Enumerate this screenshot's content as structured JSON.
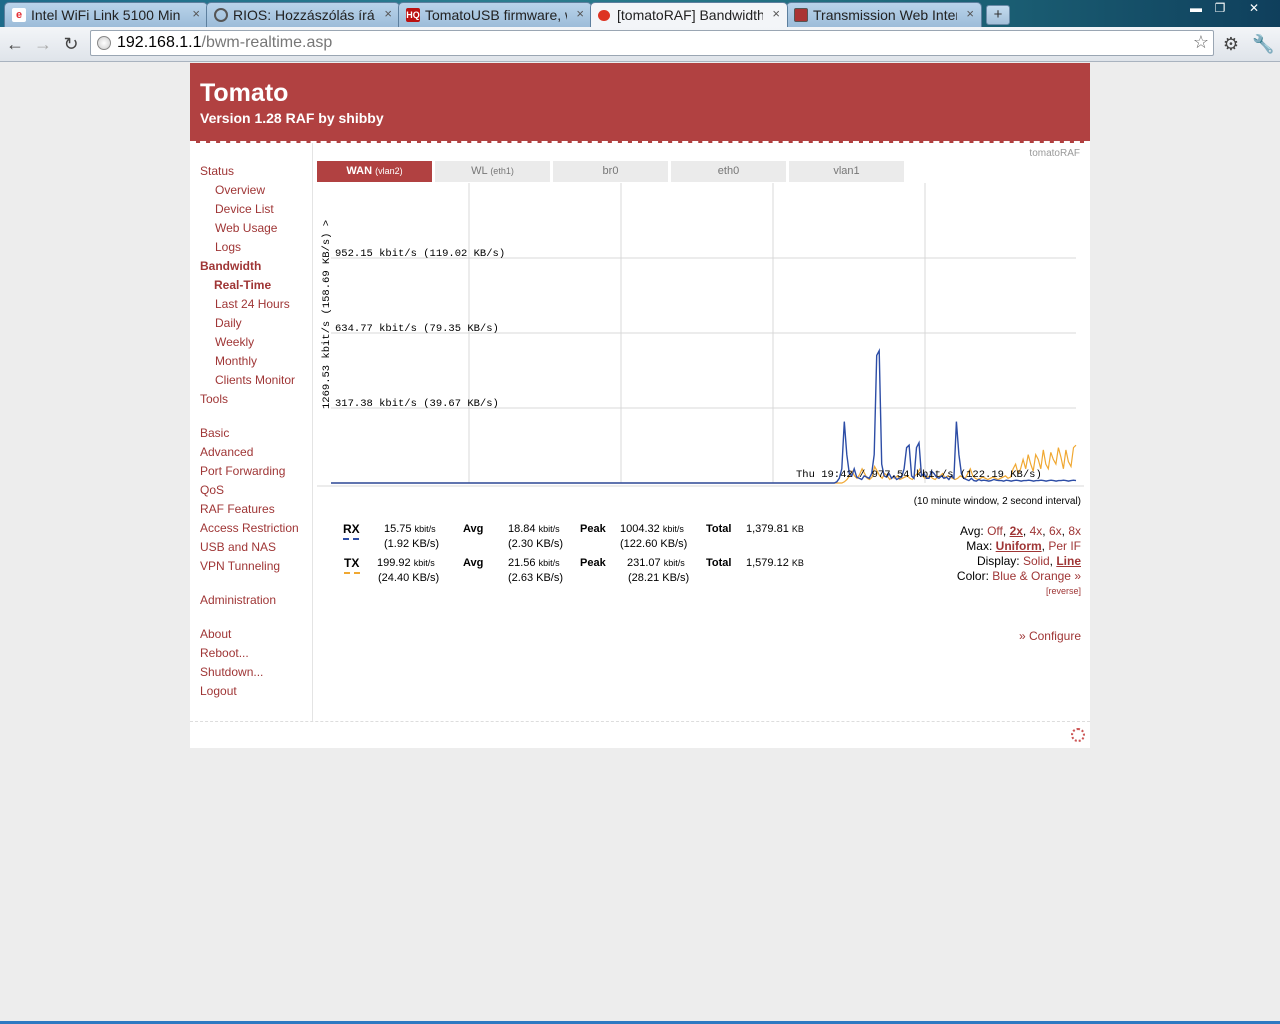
{
  "browser": {
    "tabs": [
      {
        "title": "Intel WiFi Link 5100 Min",
        "icon": "ebay-icon"
      },
      {
        "title": "RIOS: Hozzászólás írása",
        "icon": "forum-icon"
      },
      {
        "title": "TomatoUSB firmware, w",
        "icon": "hq-icon"
      },
      {
        "title": "[tomatoRAF] Bandwidth",
        "icon": "tomato-icon"
      },
      {
        "title": "Transmission Web Inter",
        "icon": "transmission-icon"
      }
    ],
    "url_host": "192.168.1.1",
    "url_path": "/bwm-realtime.asp",
    "tab_close_glyph": "×",
    "newtab_glyph": "+",
    "fav_hq": "HQ"
  },
  "header": {
    "title": "Tomato",
    "subtitle": "Version 1.28 RAF by shibby"
  },
  "sidebar": {
    "status": "Status",
    "overview": "Overview",
    "device_list": "Device List",
    "web_usage": "Web Usage",
    "logs": "Logs",
    "bandwidth": "Bandwidth",
    "real_time": "Real-Time",
    "last24": "Last 24 Hours",
    "daily": "Daily",
    "weekly": "Weekly",
    "monthly": "Monthly",
    "clients_monitor": "Clients Monitor",
    "tools": "Tools",
    "basic": "Basic",
    "advanced": "Advanced",
    "port_forwarding": "Port Forwarding",
    "qos": "QoS",
    "raf_features": "RAF Features",
    "access_restriction": "Access Restriction",
    "usb_nas": "USB and NAS",
    "vpn": "VPN Tunneling",
    "administration": "Administration",
    "about": "About",
    "reboot": "Reboot...",
    "shutdown": "Shutdown...",
    "logout": "Logout"
  },
  "brand": "tomatoRAF",
  "iface_tabs": [
    {
      "name": "WAN",
      "sub": "(vlan2)"
    },
    {
      "name": "WL",
      "sub": "(eth1)"
    },
    {
      "name": "br0",
      "sub": ""
    },
    {
      "name": "eth0",
      "sub": ""
    },
    {
      "name": "vlan1",
      "sub": ""
    }
  ],
  "graph": {
    "max_label": "1269.53 kbit/s (158.69 KB/s) >",
    "gridlines": [
      "952.15 kbit/s (119.02 KB/s)",
      "634.77 kbit/s (79.35 KB/s)",
      "317.38 kbit/s (39.67 KB/s)"
    ],
    "cursor_label": "Thu 19:42 / 977.54 kbit/s (122.19 KB/s)",
    "colors": {
      "rx": "#2d4da6",
      "tx": "#f0a832",
      "grid": "#d8d8d8"
    }
  },
  "chart_data": {
    "type": "line",
    "ylim": [
      0,
      1269.53
    ],
    "yunit": "kbit/s",
    "series": [
      {
        "name": "RX",
        "values": [
          0,
          0,
          0,
          0,
          0,
          0,
          0,
          0,
          0,
          0,
          0,
          0,
          0,
          0,
          0,
          0,
          0,
          0,
          0,
          0,
          0,
          0,
          0,
          0,
          0,
          0,
          0,
          0,
          0,
          0,
          0,
          0,
          0,
          0,
          0,
          0,
          0,
          0,
          0,
          0,
          0,
          0,
          0,
          0,
          0,
          0,
          0,
          0,
          0,
          0,
          0,
          0,
          0,
          0,
          0,
          0,
          0,
          0,
          0,
          0,
          0,
          0,
          0,
          0,
          0,
          0,
          0,
          0,
          0,
          0,
          0,
          0,
          0,
          0,
          0,
          0,
          0,
          0,
          0,
          0,
          0,
          0,
          0,
          0,
          0,
          0,
          0,
          0,
          0,
          0,
          0,
          0,
          0,
          0,
          0,
          0,
          0,
          0,
          0,
          0,
          0,
          0,
          0,
          0,
          0,
          0,
          0,
          0,
          0,
          0,
          0,
          0,
          0,
          0,
          0,
          0,
          0,
          0,
          0,
          0,
          0,
          0,
          0,
          0,
          0,
          0,
          0,
          0,
          0,
          0,
          0,
          0,
          0,
          0,
          0,
          0,
          0,
          0,
          0,
          0,
          0,
          0,
          0,
          0,
          0,
          0,
          0,
          0,
          0,
          0,
          0,
          0,
          0,
          0,
          0,
          0,
          0,
          0,
          0,
          0,
          0,
          0,
          0,
          0,
          0,
          0,
          0,
          0,
          0,
          0,
          0,
          0,
          0,
          0,
          0,
          0,
          0,
          0,
          0,
          0,
          0,
          0,
          0,
          0,
          0,
          0,
          0,
          0,
          0,
          0,
          0,
          0,
          0,
          0,
          0,
          0,
          0,
          0,
          0,
          0,
          0,
          0,
          0,
          5,
          20,
          60,
          260,
          120,
          40,
          30,
          60,
          25,
          20,
          15,
          30,
          25,
          20,
          40,
          120,
          540,
          560,
          80,
          30,
          25,
          40,
          20,
          30,
          15,
          20,
          25,
          60,
          150,
          160,
          30,
          20,
          150,
          170,
          30,
          40,
          20,
          20,
          50,
          40,
          25,
          20,
          30,
          20,
          25,
          15,
          30,
          20,
          260,
          120,
          40,
          20,
          15,
          10,
          20,
          10,
          8,
          15,
          10,
          12,
          10,
          8,
          10,
          15,
          12,
          10,
          10,
          8,
          12,
          10,
          8,
          10,
          12,
          10,
          8,
          10,
          10,
          12,
          10,
          8,
          10,
          10,
          12,
          10,
          8,
          10,
          12,
          10,
          8,
          10,
          10,
          12,
          10,
          8,
          10,
          12,
          10
        ]
      },
      {
        "name": "TX",
        "values": [
          0,
          0,
          0,
          0,
          0,
          0,
          0,
          0,
          0,
          0,
          0,
          0,
          0,
          0,
          0,
          0,
          0,
          0,
          0,
          0,
          0,
          0,
          0,
          0,
          0,
          0,
          0,
          0,
          0,
          0,
          0,
          0,
          0,
          0,
          0,
          0,
          0,
          0,
          0,
          0,
          0,
          0,
          0,
          0,
          0,
          0,
          0,
          0,
          0,
          0,
          0,
          0,
          0,
          0,
          0,
          0,
          0,
          0,
          0,
          0,
          0,
          0,
          0,
          0,
          0,
          0,
          0,
          0,
          0,
          0,
          0,
          0,
          0,
          0,
          0,
          0,
          0,
          0,
          0,
          0,
          0,
          0,
          0,
          0,
          0,
          0,
          0,
          0,
          0,
          0,
          0,
          0,
          0,
          0,
          0,
          0,
          0,
          0,
          0,
          0,
          0,
          0,
          0,
          0,
          0,
          0,
          0,
          0,
          0,
          0,
          0,
          0,
          0,
          0,
          0,
          0,
          0,
          0,
          0,
          0,
          0,
          0,
          0,
          0,
          0,
          0,
          0,
          0,
          0,
          0,
          0,
          0,
          0,
          0,
          0,
          0,
          0,
          0,
          0,
          0,
          0,
          0,
          0,
          0,
          0,
          0,
          0,
          0,
          0,
          0,
          0,
          0,
          0,
          0,
          0,
          0,
          0,
          0,
          0,
          0,
          0,
          0,
          0,
          0,
          0,
          0,
          0,
          0,
          0,
          0,
          0,
          0,
          0,
          0,
          0,
          0,
          0,
          0,
          0,
          0,
          0,
          0,
          0,
          0,
          0,
          0,
          0,
          0,
          0,
          0,
          0,
          0,
          0,
          0,
          0,
          0,
          0,
          0,
          0,
          0,
          0,
          0,
          0,
          0,
          5,
          15,
          30,
          50,
          30,
          20,
          35,
          60,
          40,
          20,
          15,
          25,
          70,
          50,
          30,
          20,
          40,
          30,
          15,
          25,
          20,
          30,
          15,
          20,
          25,
          30,
          20,
          15,
          30,
          40,
          60,
          30,
          20,
          25,
          30,
          20,
          15,
          25,
          30,
          40,
          20,
          30,
          25,
          20,
          15,
          20,
          30,
          25,
          20,
          40,
          60,
          30,
          20,
          15,
          20,
          25,
          20,
          15,
          20,
          25,
          20,
          15,
          20,
          25,
          30,
          20,
          25,
          60,
          80,
          40,
          60,
          100,
          60,
          120,
          80,
          50,
          120,
          100,
          60,
          140,
          80,
          60,
          130,
          100,
          80,
          150,
          110,
          60,
          140,
          90,
          70,
          150,
          160
        ]
      }
    ]
  },
  "interval": "(10 minute window, 2 second interval)",
  "stats": {
    "rx_label": "RX",
    "tx_label": "TX",
    "avg": "Avg",
    "peak": "Peak",
    "total": "Total",
    "rx_cur": "15.75",
    "rx_cur_kb": "(1.92 KB/s)",
    "rx_avg": "18.84",
    "rx_avg_kb": "(2.30 KB/s)",
    "rx_peak": "1004.32",
    "rx_peak_kb": "(122.60 KB/s)",
    "rx_total": "1,379.81",
    "tx_cur": "199.92",
    "tx_cur_kb": "(24.40 KB/s)",
    "tx_avg": "21.56",
    "tx_avg_kb": "(2.63 KB/s)",
    "tx_peak": "231.07",
    "tx_peak_kb": "(28.21 KB/s)",
    "tx_total": "1,579.12",
    "unit_rate": "kbit/s",
    "unit_total": "KB"
  },
  "options": {
    "avg_label": "Avg:",
    "avg_opts": [
      "Off",
      "2x",
      "4x",
      "6x",
      "8x"
    ],
    "avg_selected": "2x",
    "max_label": "Max:",
    "max_opts": [
      "Uniform",
      "Per IF"
    ],
    "max_selected": "Uniform",
    "display_label": "Display:",
    "display_opts": [
      "Solid",
      "Line"
    ],
    "display_selected": "Line",
    "color_label": "Color:",
    "color_value": "Blue & Orange »",
    "reverse": "[reverse]",
    "configure": "» Configure"
  }
}
